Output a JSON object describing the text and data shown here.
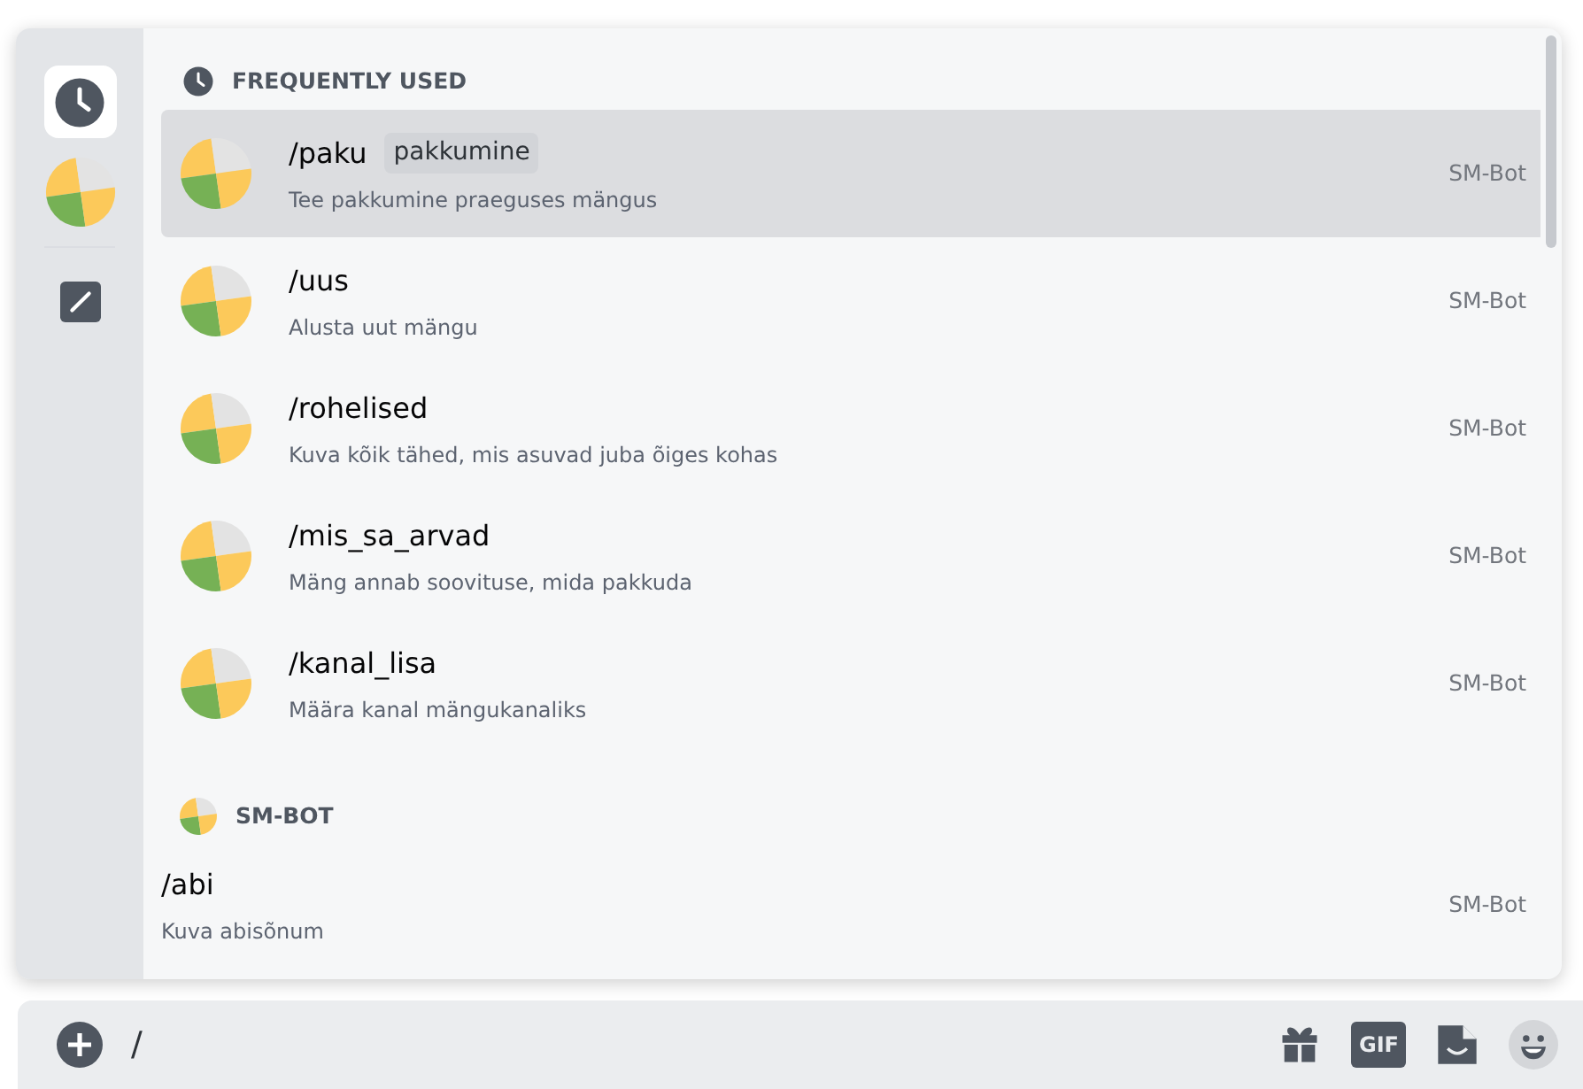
{
  "sidebar": {
    "items": [
      {
        "kind": "recent",
        "selected": true
      },
      {
        "kind": "bot",
        "selected": false
      },
      {
        "kind": "builtin",
        "selected": false
      }
    ]
  },
  "groups": [
    {
      "kind": "recent",
      "title": "FREQUENTLY USED",
      "commands": [
        {
          "name": "/paku",
          "option": "pakkumine",
          "description": "Tee pakkumine praeguses mängus",
          "source": "SM-Bot",
          "selected": true
        },
        {
          "name": "/uus",
          "description": "Alusta uut mängu",
          "source": "SM-Bot",
          "selected": false
        },
        {
          "name": "/rohelised",
          "description": "Kuva kõik tähed, mis asuvad juba õiges kohas",
          "source": "SM-Bot",
          "selected": false
        },
        {
          "name": "/mis_sa_arvad",
          "description": "Mäng annab soovituse, mida pakkuda",
          "source": "SM-Bot",
          "selected": false
        },
        {
          "name": "/kanal_lisa",
          "description": "Määra kanal mängukanaliks",
          "source": "SM-Bot",
          "selected": false
        }
      ]
    },
    {
      "kind": "bot",
      "title": "SM-BOT",
      "commands": [
        {
          "name": "/abi",
          "description": "Kuva abisõnum",
          "source": "SM-Bot",
          "selected": false
        }
      ]
    }
  ],
  "input": {
    "value": "/"
  },
  "toolbar": [
    {
      "kind": "gift"
    },
    {
      "kind": "gif",
      "label": "GIF"
    },
    {
      "kind": "sticker"
    },
    {
      "kind": "emoji"
    }
  ]
}
